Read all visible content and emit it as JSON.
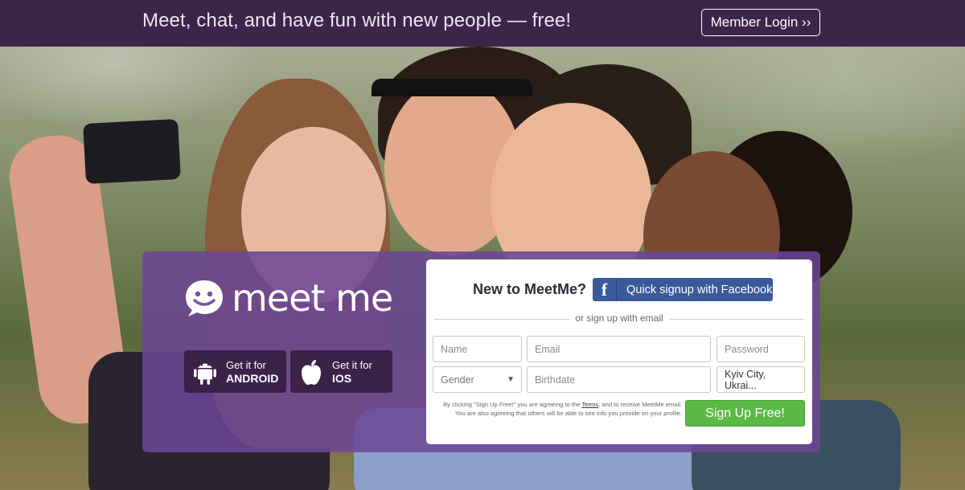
{
  "topbar": {
    "tagline": "Meet, chat, and have fun with new people — free!",
    "login_label": "Member Login ››"
  },
  "hero": {
    "background_description": "group selfie of four friends"
  },
  "brand": {
    "logo_text": "meet me",
    "logo_icon": "smiley-chat-bubble-icon"
  },
  "apps": [
    {
      "line1": "Get it for",
      "line2": "ANDROID",
      "icon": "android-icon"
    },
    {
      "line1": "Get it for",
      "line2": "IOS",
      "icon": "apple-icon"
    }
  ],
  "signup": {
    "title": "New to MeetMe?",
    "facebook_label": "Quick signup with Facebook",
    "divider_text": "or sign up with email",
    "fields": {
      "name_placeholder": "Name",
      "email_placeholder": "Email",
      "password_placeholder": "Password",
      "gender_value": "Gender",
      "birthdate_placeholder": "Birthdate",
      "city_value": "Kyiv City, Ukrai..."
    },
    "legal_pre": "By clicking \"Sign Up Free!\" you are agreeing to the ",
    "legal_link": "Terms",
    "legal_post": ", and to receive MeetMe email. You are also agreeing that others will be able to see info you provide on your profile.",
    "submit_label": "Sign Up Free!"
  },
  "colors": {
    "topbar": "#3c2548",
    "panel": "#6c4696",
    "facebook": "#3a5a9a",
    "signup_button": "#5cb945"
  }
}
